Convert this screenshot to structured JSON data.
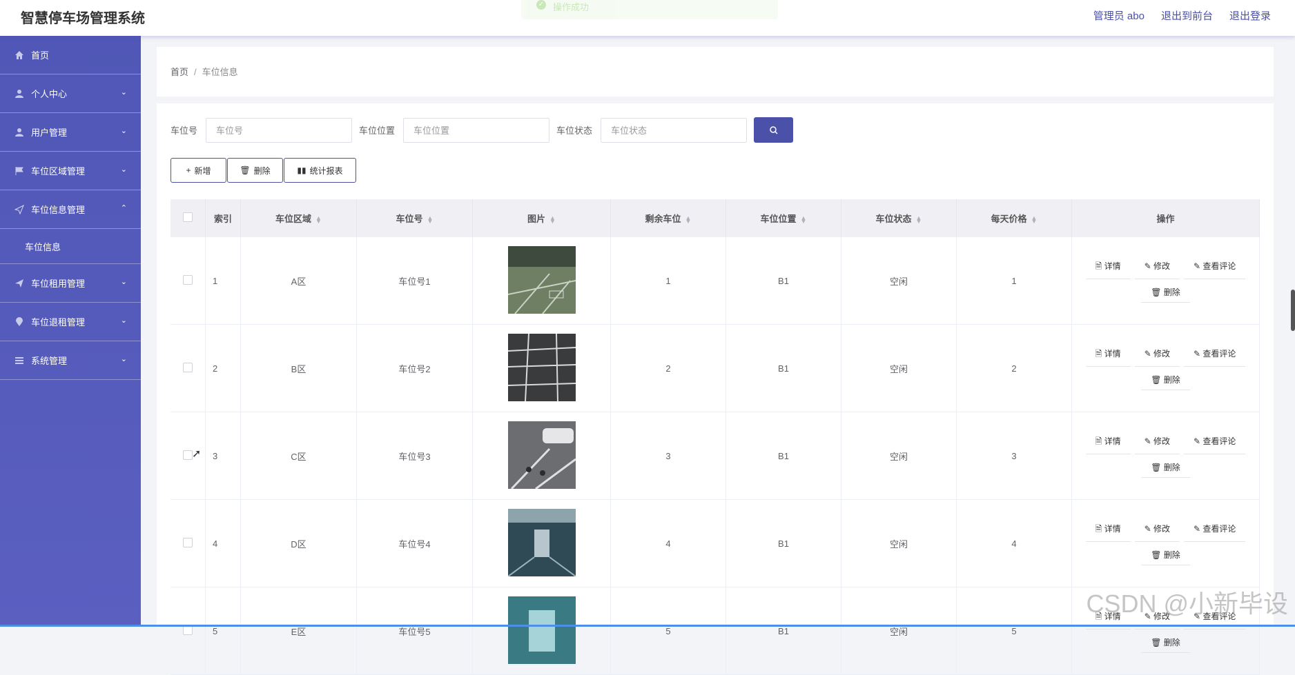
{
  "app": {
    "title": "智慧停车场管理系统"
  },
  "toast": {
    "message": "操作成功"
  },
  "topbar": {
    "admin_label": "管理员 abo",
    "front_link": "退出到前台",
    "logout_link": "退出登录"
  },
  "sidebar": {
    "items": [
      {
        "label": "首页",
        "icon": "home-icon",
        "expandable": false
      },
      {
        "label": "个人中心",
        "icon": "user-icon",
        "expandable": true
      },
      {
        "label": "用户管理",
        "icon": "user-icon",
        "expandable": true
      },
      {
        "label": "车位区域管理",
        "icon": "flag-icon",
        "expandable": true
      },
      {
        "label": "车位信息管理",
        "icon": "send-icon",
        "expandable": true,
        "expanded": true,
        "sub": "车位信息"
      },
      {
        "label": "车位租用管理",
        "icon": "plane-icon",
        "expandable": true
      },
      {
        "label": "车位退租管理",
        "icon": "location-icon",
        "expandable": true
      },
      {
        "label": "系统管理",
        "icon": "menu-icon",
        "expandable": true
      }
    ]
  },
  "breadcrumb": {
    "home": "首页",
    "separator": "/",
    "current": "车位信息"
  },
  "search": {
    "field1_label": "车位号",
    "field1_placeholder": "车位号",
    "field2_label": "车位位置",
    "field2_placeholder": "车位位置",
    "field3_label": "车位状态",
    "field3_placeholder": "车位状态"
  },
  "actions": {
    "add": "新增",
    "delete": "删除",
    "report": "统计报表"
  },
  "table": {
    "headers": [
      "索引",
      "车位区域",
      "车位号",
      "图片",
      "剩余车位",
      "车位位置",
      "车位状态",
      "每天价格",
      "操作"
    ],
    "rows": [
      {
        "index": "1",
        "area": "A区",
        "no": "车位号1",
        "remain": "1",
        "pos": "B1",
        "status": "空闲",
        "price": "1"
      },
      {
        "index": "2",
        "area": "B区",
        "no": "车位号2",
        "remain": "2",
        "pos": "B1",
        "status": "空闲",
        "price": "2"
      },
      {
        "index": "3",
        "area": "C区",
        "no": "车位号3",
        "remain": "3",
        "pos": "B1",
        "status": "空闲",
        "price": "3"
      },
      {
        "index": "4",
        "area": "D区",
        "no": "车位号4",
        "remain": "4",
        "pos": "B1",
        "status": "空闲",
        "price": "4"
      },
      {
        "index": "5",
        "area": "E区",
        "no": "车位号5",
        "remain": "5",
        "pos": "B1",
        "status": "空闲",
        "price": "5"
      }
    ],
    "op_detail": "详情",
    "op_edit": "修改",
    "op_comment": "查看评论",
    "op_delete": "删除"
  },
  "watermark": "CSDN @小新毕设",
  "colors": {
    "primary": "#4b50a8",
    "sidebar": "#5057b6"
  }
}
